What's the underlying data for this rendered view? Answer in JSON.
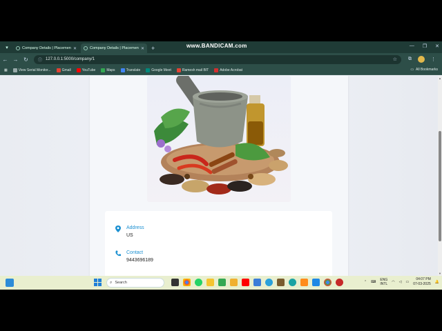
{
  "browser": {
    "tabs": [
      {
        "title": "Company Details | Placement Pr",
        "active": false
      },
      {
        "title": "Company Details | Placement Pr",
        "active": true
      }
    ],
    "recording_watermark": "www.BANDICAM.com",
    "url": "127.0.0.1:5000/company/1",
    "bookmarks": [
      {
        "label": "View Serial Monitor...",
        "color": "#9aa"
      },
      {
        "label": "Gmail",
        "color": "#e34234"
      },
      {
        "label": "YouTube",
        "color": "#ff0000"
      },
      {
        "label": "Maps",
        "color": "#34a853"
      },
      {
        "label": "Translate",
        "color": "#4285f4"
      },
      {
        "label": "Google Meet",
        "color": "#00897b"
      },
      {
        "label": "Ramesh mail BIT",
        "color": "#e34234"
      },
      {
        "label": "Adobe Acrobat",
        "color": "#d32f2f"
      }
    ],
    "all_bookmarks": "All Bookmarks"
  },
  "company": {
    "hero_alt": "herbs and spices with mortar and pestle",
    "address_label": "Address",
    "address_value": "US",
    "contact_label": "Contact",
    "contact_value": "9443696189"
  },
  "taskbar": {
    "search_placeholder": "Search",
    "lang_top": "ENG",
    "lang_bottom": "INTL",
    "time": "04:07 PM",
    "date": "07-03-2025"
  },
  "colors": {
    "accent": "#1a8fd1",
    "chrome": "#2d4e48",
    "taskbar": "#e9efcf"
  }
}
